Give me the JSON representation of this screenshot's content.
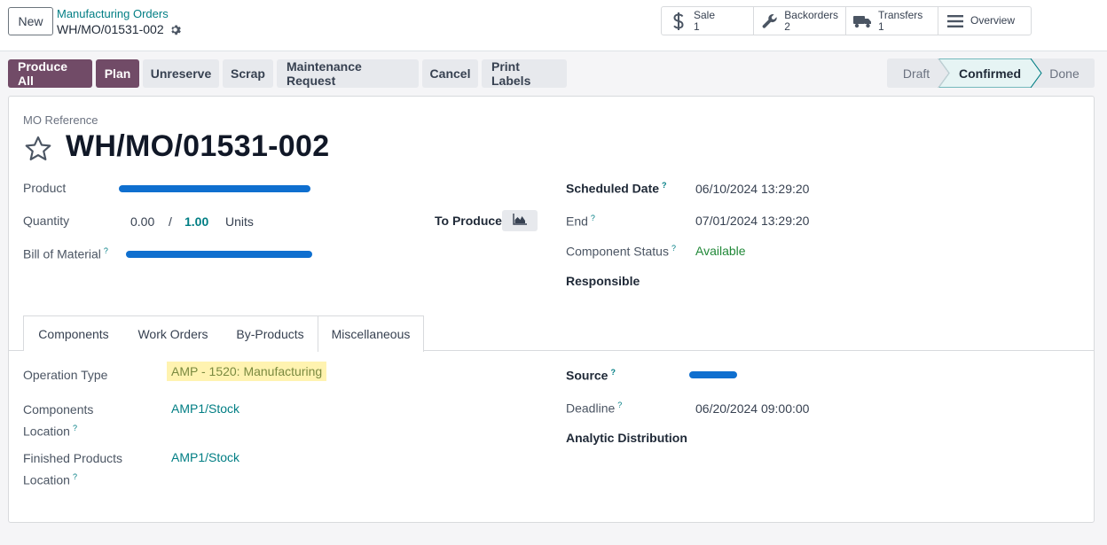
{
  "topbar": {
    "new_label": "New",
    "breadcrumb_parent": "Manufacturing Orders",
    "breadcrumb_current": "WH/MO/01531-002"
  },
  "smart_buttons": [
    {
      "icon": "dollar-icon",
      "label": "Sale",
      "value": "1"
    },
    {
      "icon": "wrench-icon",
      "label": "Backorders",
      "value": "2"
    },
    {
      "icon": "truck-icon",
      "label": "Transfers",
      "value": "1"
    },
    {
      "icon": "list-icon",
      "label": "Overview",
      "value": ""
    }
  ],
  "actions": {
    "produce_all": "Produce All",
    "plan": "Plan",
    "unreserve": "Unreserve",
    "scrap": "Scrap",
    "maintenance": "Maintenance Request",
    "cancel": "Cancel",
    "print_labels": "Print Labels"
  },
  "status": {
    "stages": [
      "Draft",
      "Confirmed",
      "Done"
    ],
    "current": "Confirmed"
  },
  "form": {
    "ref_label": "MO Reference",
    "ref_value": "WH/MO/01531-002",
    "product_label": "Product",
    "quantity_label": "Quantity",
    "quantity_done": "0.00",
    "quantity_sep": "/",
    "quantity_total": "1.00",
    "quantity_uom": "Units",
    "to_produce_label": "To Produce",
    "bom_label": "Bill of Material",
    "scheduled_label": "Scheduled Date",
    "scheduled_value": "06/10/2024 13:29:20",
    "end_label": "End",
    "end_value": "07/01/2024 13:29:20",
    "component_status_label": "Component Status",
    "component_status_value": "Available",
    "responsible_label": "Responsible"
  },
  "tabs": [
    "Components",
    "Work Orders",
    "By-Products",
    "Miscellaneous"
  ],
  "active_tab": "Miscellaneous",
  "misc": {
    "operation_type_label": "Operation Type",
    "operation_type_value": "AMP - 1520: Manufacturing",
    "components_location_label_1": "Components",
    "components_location_label_2": "Location",
    "components_location_value": "AMP1/Stock",
    "finished_location_label_1": "Finished Products",
    "finished_location_label_2": "Location",
    "finished_location_value": "AMP1/Stock",
    "source_label": "Source",
    "deadline_label": "Deadline",
    "deadline_value": "06/20/2024 09:00:00",
    "analytic_label": "Analytic Distribution"
  },
  "help_mark": "?",
  "colors": {
    "primary": "#714b67",
    "link": "#017e84",
    "available": "#218838",
    "highlight": "#fff3b0",
    "redaction": "#0f6fcf"
  }
}
